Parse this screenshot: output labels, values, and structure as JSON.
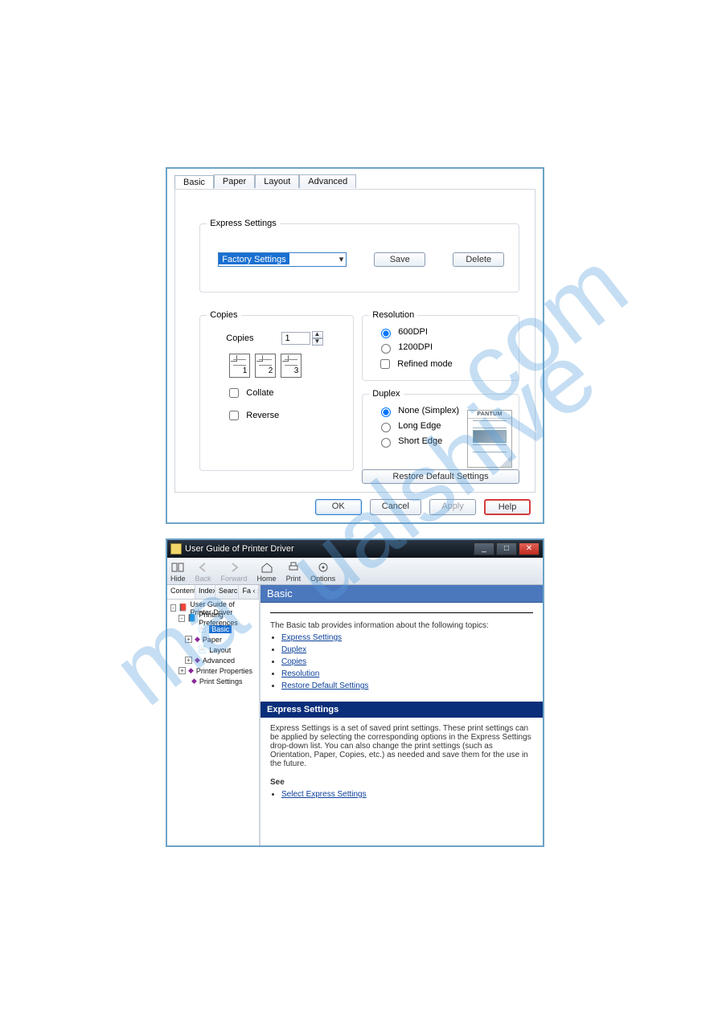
{
  "dialog1": {
    "tabs": [
      "Basic",
      "Paper",
      "Layout",
      "Advanced"
    ],
    "express": {
      "legend": "Express Settings",
      "selected": "Factory Settings",
      "save": "Save",
      "delete": "Delete"
    },
    "copies": {
      "legend": "Copies",
      "label": "Copies",
      "value": "1",
      "pages": [
        "1",
        "2",
        "3"
      ],
      "collate": "Collate",
      "reverse": "Reverse"
    },
    "resolution": {
      "legend": "Resolution",
      "opt600": "600DPI",
      "opt1200": "1200DPI",
      "refined": "Refined mode"
    },
    "duplex": {
      "legend": "Duplex",
      "none": "None (Simplex)",
      "long": "Long Edge",
      "short": "Short Edge",
      "previewTitle": "PANTUM"
    },
    "restore": "Restore Default Settings",
    "buttons": {
      "ok": "OK",
      "cancel": "Cancel",
      "apply": "Apply",
      "help": "Help"
    }
  },
  "help": {
    "title": "User Guide of Printer Driver",
    "winbtns": {
      "min": "_",
      "max": "□",
      "close": "✕"
    },
    "toolbar": [
      {
        "key": "hide",
        "label": "Hide",
        "disabled": false
      },
      {
        "key": "back",
        "label": "Back",
        "disabled": true
      },
      {
        "key": "forward",
        "label": "Forward",
        "disabled": true
      },
      {
        "key": "home",
        "label": "Home",
        "disabled": false
      },
      {
        "key": "print",
        "label": "Print",
        "disabled": false
      },
      {
        "key": "options",
        "label": "Options",
        "disabled": false
      }
    ],
    "subtabs": [
      "Contents",
      "Index",
      "Search",
      "Fa ‹ ›"
    ],
    "tree": {
      "root": "User Guide of Printer Driver",
      "printing": "Printing Preferences",
      "basic": "Basic",
      "paper": "Paper",
      "layout": "Layout",
      "advanced": "Advanced",
      "props": "Printer Properties",
      "settings": "Print Settings"
    },
    "topicTitle": "Basic",
    "intro": "The Basic tab provides information about the following topics:",
    "links": [
      "Express Settings",
      "Duplex",
      "Copies",
      "Resolution",
      "Restore Default Settings"
    ],
    "section": {
      "title": "Express Settings",
      "body": "Express Settings is a set of saved print settings. These print settings can be applied by selecting the corresponding options in the Express Settings drop-down list. You can also change the print settings (such as Orientation, Paper, Copies, etc.) as needed and save them for the use in the future."
    },
    "see": "See",
    "seeLink": "Select Express Settings"
  }
}
